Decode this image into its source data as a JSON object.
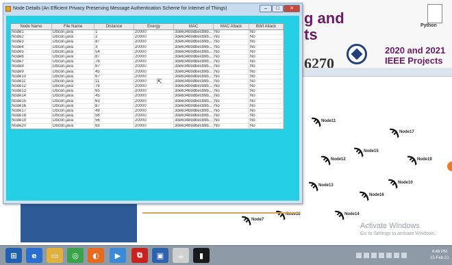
{
  "window": {
    "title": "Node Details (An Efficient Privacy Preserving Message Authentication Scheme for Internet of Things)",
    "controls": {
      "minimize": "–",
      "maximize": "□",
      "close": "✕"
    }
  },
  "table": {
    "columns": [
      "Node Name",
      "File Name",
      "Distance",
      "Energy",
      "MAC",
      "MAC Attack",
      "BWI Attack"
    ],
    "rows": [
      [
        "Node1",
        "Dbcon.java",
        "1",
        "20000",
        "3de634b9dbecb9b...",
        "No",
        "No"
      ],
      [
        "Node2",
        "Dbcon.java",
        "2",
        "20000",
        "3de634b9dbecb9b...",
        "No",
        "No"
      ],
      [
        "Node3",
        "Dbcon.java",
        "87",
        "20000",
        "3de634b9dbecb9b...",
        "No",
        "No"
      ],
      [
        "Node4",
        "Dbcon.java",
        "3",
        "20000",
        "3de634b9dbecb9b...",
        "No",
        "No"
      ],
      [
        "Node5",
        "Dbcon.java",
        "54",
        "20000",
        "3de634b9dbecb9b...",
        "No",
        "No"
      ],
      [
        "Node6",
        "Dbcon.java",
        "87",
        "20000",
        "3de634b9dbecb9b...",
        "No",
        "No"
      ],
      [
        "Node7",
        "Dbcon.java",
        "76",
        "20000",
        "3de634b9dbecb9b...",
        "No",
        "No"
      ],
      [
        "Node8",
        "Dbcon.java",
        "87",
        "20000",
        "3de634b9dbecb9b...",
        "No",
        "No"
      ],
      [
        "Node9",
        "Dbcon.java",
        "45",
        "20000",
        "3de634b9dbecb9b...",
        "No",
        "No"
      ],
      [
        "Node10",
        "Dbcon.java",
        "67",
        "20000",
        "3de634b9dbecb9b...",
        "No",
        "No"
      ],
      [
        "Node11",
        "Dbcon.java",
        "11",
        "20000",
        "3de634b9dbecb9b...",
        "No",
        "No"
      ],
      [
        "Node12",
        "Dbcon.java",
        "76",
        "20000",
        "3de634b9dbecb9b...",
        "No",
        "No"
      ],
      [
        "Node13",
        "Dbcon.java",
        "65",
        "20000",
        "3de634b9dbecb9b...",
        "No",
        "No"
      ],
      [
        "Node14",
        "Dbcon.java",
        "45",
        "20000",
        "3de634b9dbecb9b...",
        "No",
        "No"
      ],
      [
        "Node15",
        "Dbcon.java",
        "63",
        "20000",
        "3de634b9dbecb9b...",
        "No",
        "No"
      ],
      [
        "Node16",
        "Dbcon.java",
        "87",
        "20000",
        "3de634b9dbecb9b...",
        "No",
        "No"
      ],
      [
        "Node17",
        "Dbcon.java",
        "49",
        "20000",
        "3de634b9dbecb9b...",
        "No",
        "No"
      ],
      [
        "Node18",
        "Dbcon.java",
        "58",
        "20000",
        "3de634b9dbecb9b...",
        "No",
        "No"
      ],
      [
        "Node19",
        "Dbcon.java",
        "56",
        "20000",
        "3de634b9dbecb9b...",
        "No",
        "No"
      ],
      [
        "Node20",
        "Dbcon.java",
        "65",
        "20000",
        "3de634b9dbecb9b...",
        "No",
        "No"
      ]
    ]
  },
  "background": {
    "banner": {
      "line1": "g and",
      "line2": "ts",
      "number": "6270",
      "years": "2020 and 2021",
      "subtitle": "IEEE Projects"
    },
    "doc_label": "Python",
    "nodes": [
      {
        "label": "Node11"
      },
      {
        "label": "Node17"
      },
      {
        "label": "Node15"
      },
      {
        "label": "Node12"
      },
      {
        "label": "Node19"
      },
      {
        "label": "Node13"
      },
      {
        "label": "Node10"
      },
      {
        "label": "Node16"
      },
      {
        "label": "Node18"
      },
      {
        "label": "Node14"
      },
      {
        "label": "Node7"
      }
    ],
    "watermark": {
      "title": "Activate Windows",
      "subtitle": "Go to Settings to activate Windows."
    }
  },
  "taskbar": {
    "icons": [
      {
        "name": "start-icon",
        "color": "#1f5fb0"
      },
      {
        "name": "ie-icon",
        "color": "#2a6fd0"
      },
      {
        "name": "explorer-icon",
        "color": "#e0b040"
      },
      {
        "name": "chrome-icon",
        "color": "#3aa34a"
      },
      {
        "name": "firefox-icon",
        "color": "#e86a1e"
      },
      {
        "name": "media-icon",
        "color": "#3a8ad8"
      },
      {
        "name": "acrobat-icon",
        "color": "#c8221e"
      },
      {
        "name": "app-icon",
        "color": "#2c62b0"
      },
      {
        "name": "java-icon",
        "color": "#d0d0d0"
      },
      {
        "name": "cmd-icon",
        "color": "#1a1a1a"
      }
    ],
    "clock": {
      "time": "4:46 PM",
      "date": "15-Feb-21"
    }
  }
}
